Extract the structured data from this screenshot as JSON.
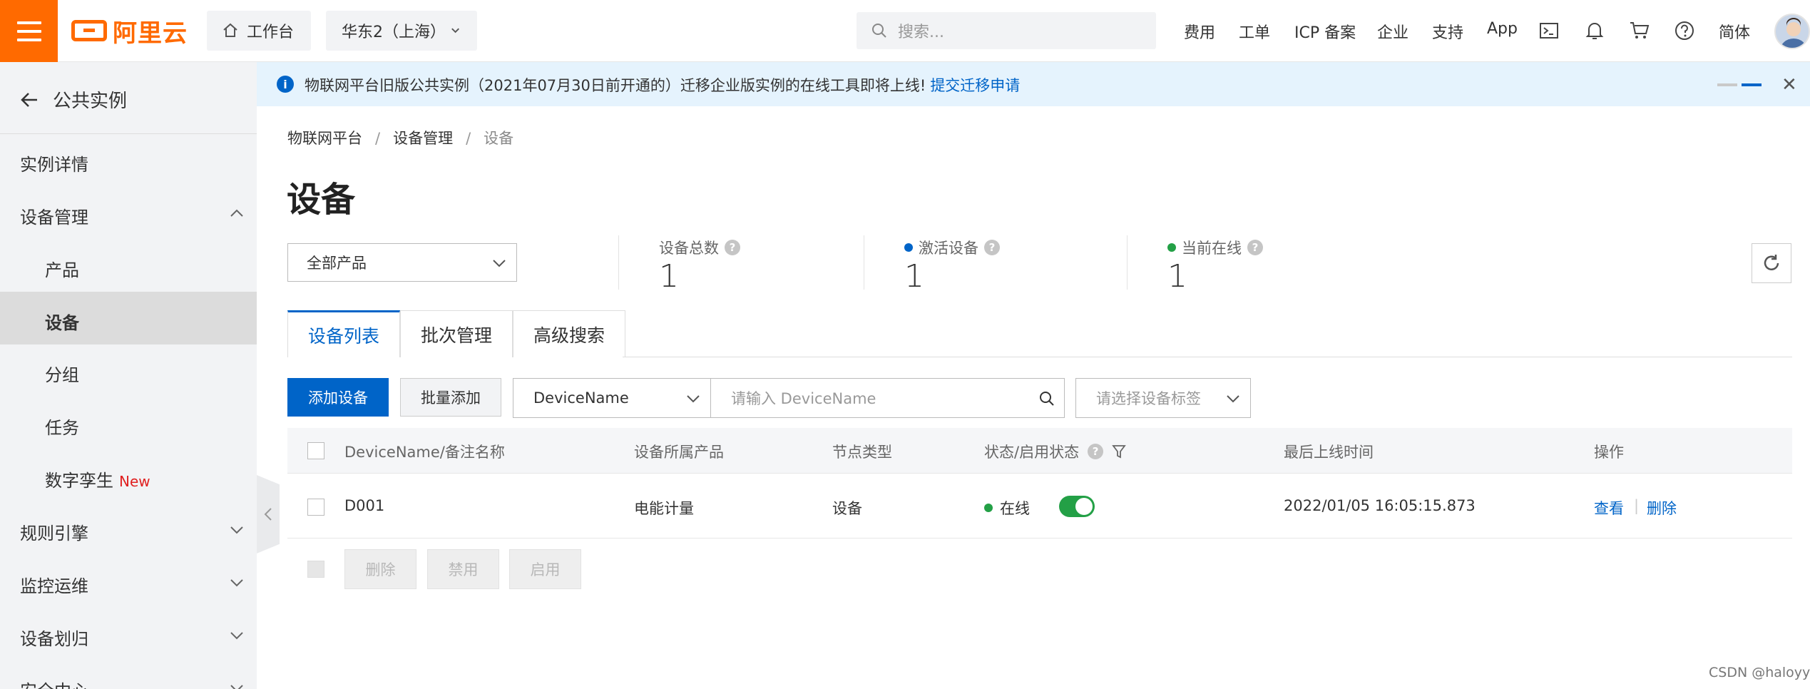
{
  "topbar": {
    "logo_text": "阿里云",
    "workbench_label": "工作台",
    "region_label": "华东2（上海）",
    "search_placeholder": "搜索...",
    "nav": [
      "费用",
      "工单",
      "ICP 备案",
      "企业",
      "支持",
      "App"
    ],
    "lang_label": "简体"
  },
  "sidebar": {
    "back_label": "公共实例",
    "items": [
      {
        "label": "实例详情"
      },
      {
        "label": "设备管理"
      },
      {
        "label": "产品"
      },
      {
        "label": "设备"
      },
      {
        "label": "分组"
      },
      {
        "label": "任务"
      },
      {
        "label": "数字孪生",
        "badge": "New"
      },
      {
        "label": "规则引擎"
      },
      {
        "label": "监控运维"
      },
      {
        "label": "设备划归"
      },
      {
        "label": "安全中心"
      }
    ]
  },
  "banner": {
    "message": "物联网平台旧版公共实例（2021年07月30日前开通的）迁移企业版实例的在线工具即将上线!",
    "link": "提交迁移申请"
  },
  "breadcrumb": [
    "物联网平台",
    "设备管理",
    "设备"
  ],
  "page_title": "设备",
  "product_select": "全部产品",
  "stats": [
    {
      "label": "设备总数",
      "value": "1"
    },
    {
      "label": "激活设备",
      "value": "1",
      "dot_color": "#0064c8"
    },
    {
      "label": "当前在线",
      "value": "1",
      "dot_color": "#23a046"
    }
  ],
  "tabs": [
    "设备列表",
    "批次管理",
    "高级搜索"
  ],
  "toolbar": {
    "add_device": "添加设备",
    "batch_add": "批量添加",
    "field_select": "DeviceName",
    "search_placeholder": "请输入 DeviceName",
    "tag_placeholder": "请选择设备标签"
  },
  "table": {
    "headers": [
      "DeviceName/备注名称",
      "设备所属产品",
      "节点类型",
      "状态/启用状态",
      "最后上线时间",
      "操作"
    ],
    "rows": [
      {
        "name": "D001",
        "product": "电能计量",
        "node_type": "设备",
        "status": "在线",
        "status_color": "#23a046",
        "last_online": "2022/01/05 16:05:15.873",
        "action_view": "查看",
        "action_delete": "删除"
      }
    ]
  },
  "bulk_actions": [
    "删除",
    "禁用",
    "启用"
  ],
  "watermark": "CSDN @haloyy",
  "colors": {
    "brand": "#ff6a00",
    "primary": "#0064c8",
    "online": "#23a046"
  }
}
